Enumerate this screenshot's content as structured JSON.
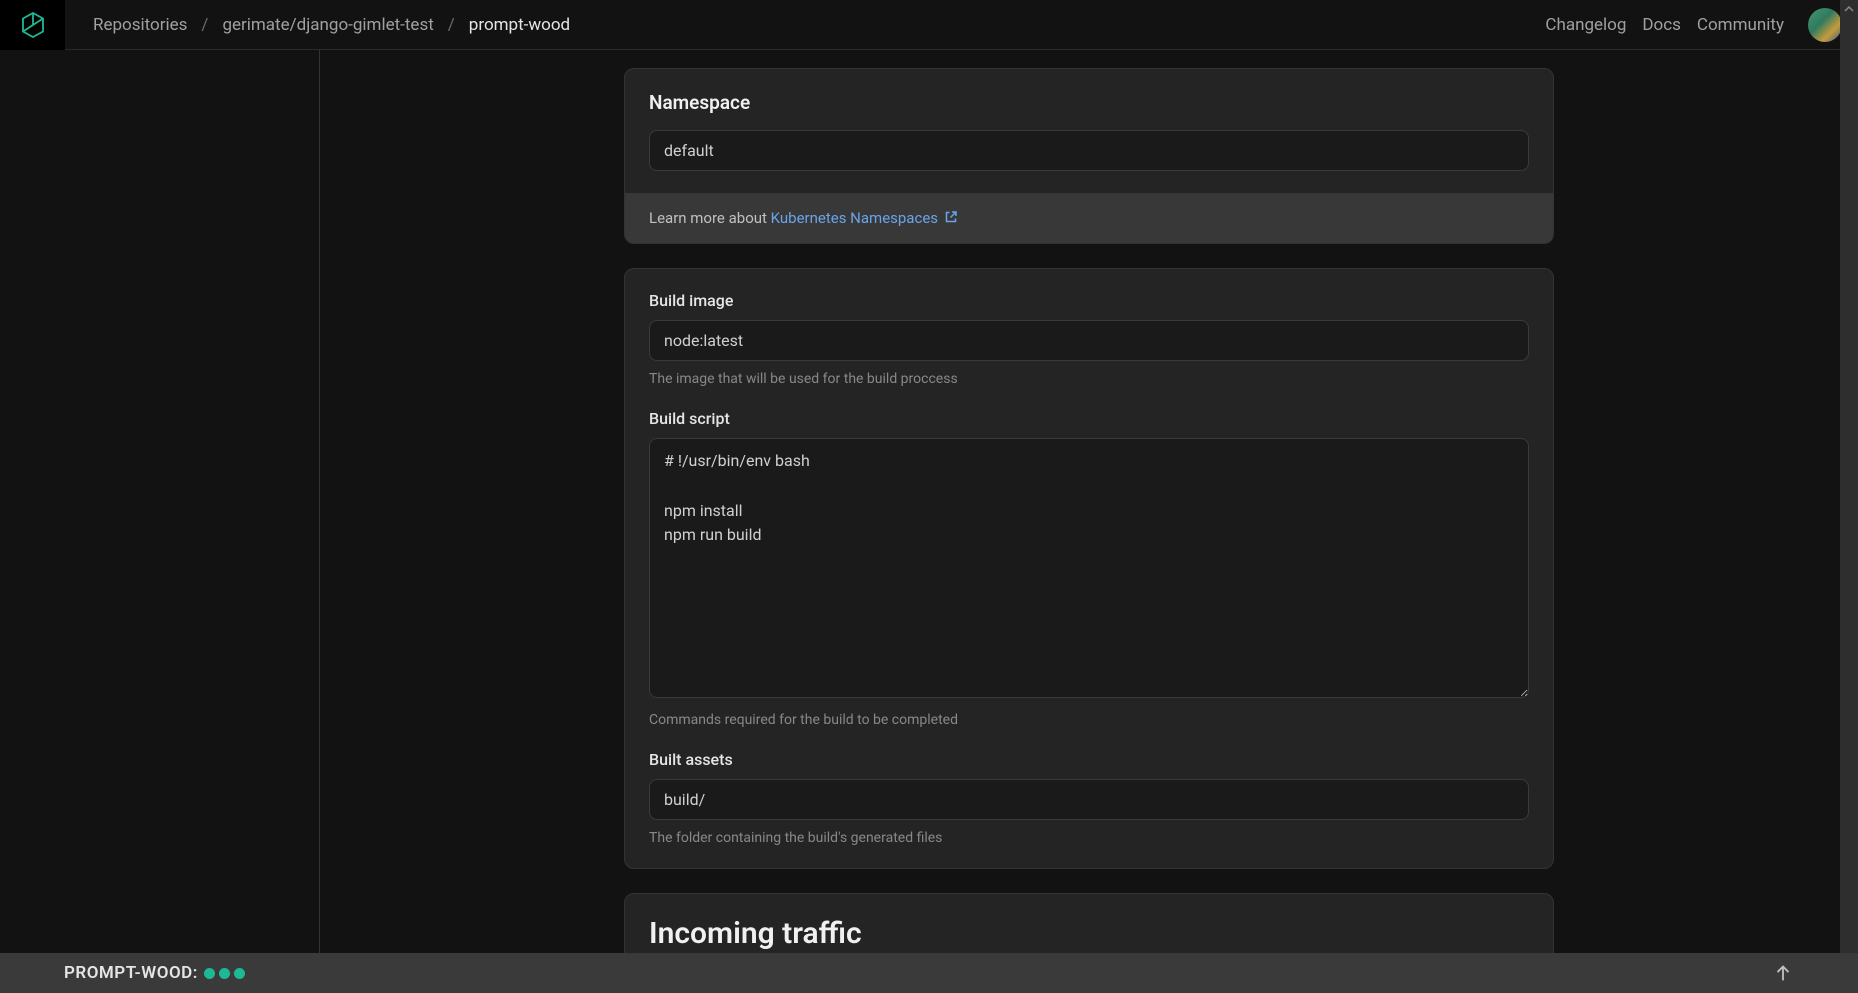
{
  "header": {
    "breadcrumbs": [
      {
        "label": "Repositories",
        "active": false
      },
      {
        "label": "gerimate/django-gimlet-test",
        "active": false
      },
      {
        "label": "prompt-wood",
        "active": true
      }
    ],
    "links": {
      "changelog": "Changelog",
      "docs": "Docs",
      "community": "Community"
    }
  },
  "namespace": {
    "title": "Namespace",
    "value": "default",
    "learn_more_prefix": "Learn more about ",
    "learn_more_link": "Kubernetes Namespaces"
  },
  "build": {
    "image": {
      "label": "Build image",
      "value": "node:latest",
      "help": "The image that will be used for the build proccess"
    },
    "script": {
      "label": "Build script",
      "value": "# !/usr/bin/env bash\n\nnpm install\nnpm run build",
      "help": "Commands required for the build to be completed"
    },
    "assets": {
      "label": "Built assets",
      "value": "build/",
      "help": "The folder containing the build's generated files"
    }
  },
  "traffic": {
    "title": "Incoming traffic"
  },
  "footer": {
    "label": "PROMPT-WOOD:",
    "status_count": 3
  }
}
